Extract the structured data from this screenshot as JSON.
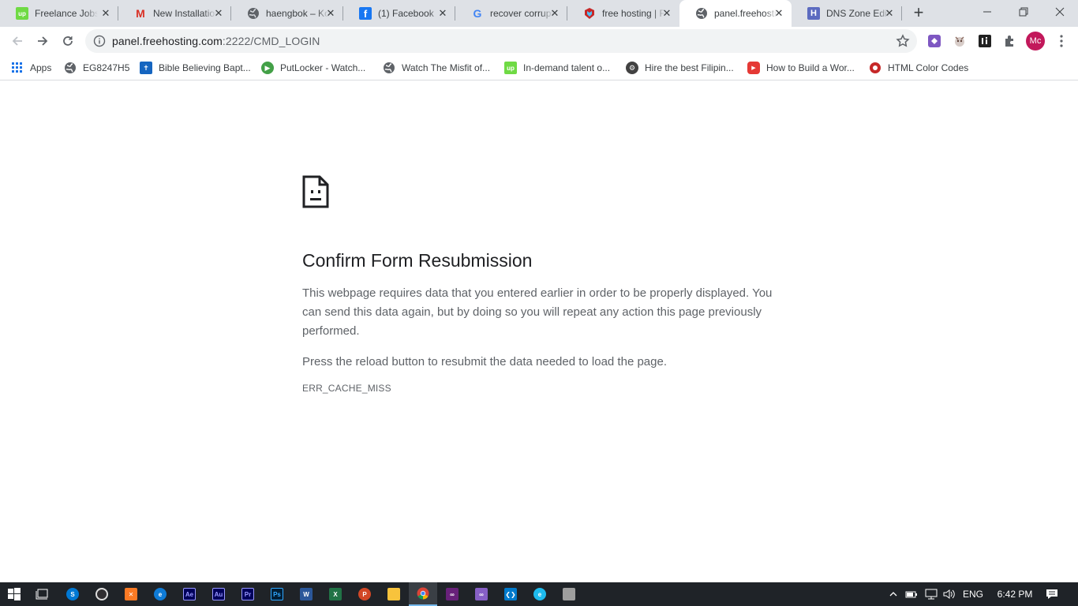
{
  "tabs": [
    {
      "title": "Freelance Jobs",
      "favicon": "upwork-icon",
      "color": "#6fda44",
      "glyph": "up"
    },
    {
      "title": "New Installation",
      "favicon": "gmail-icon",
      "color": "#ffffff",
      "glyph": "M"
    },
    {
      "title": "haengbok – Korean",
      "favicon": "globe-icon",
      "color": "#5f6368",
      "glyph": ""
    },
    {
      "title": "(1) Facebook",
      "favicon": "facebook-icon",
      "color": "#1877f2",
      "glyph": "f"
    },
    {
      "title": "recover corrupted",
      "favicon": "google-icon",
      "color": "#ffffff",
      "glyph": "G"
    },
    {
      "title": "free hosting | Free",
      "favicon": "freehosting-icon",
      "color": "#c62828",
      "glyph": ""
    },
    {
      "title": "panel.freehosting",
      "favicon": "globe-icon",
      "color": "#5f6368",
      "glyph": ""
    },
    {
      "title": "DNS Zone Editor",
      "favicon": "dns-icon",
      "color": "#5c6bc0",
      "glyph": "H"
    }
  ],
  "omnibox": {
    "host": "panel.freehosting.com",
    "path": ":2222/CMD_LOGIN"
  },
  "profile_initials": "Mc",
  "bookmarks": [
    {
      "label": "Apps",
      "icon": "apps-grid-icon"
    },
    {
      "label": "EG8247H5",
      "icon": "globe-icon"
    },
    {
      "label": "Bible Believing Bapt...",
      "icon": "bible-icon"
    },
    {
      "label": "PutLocker - Watch...",
      "icon": "play-icon"
    },
    {
      "label": "Watch The Misfit of...",
      "icon": "globe-icon"
    },
    {
      "label": "In-demand talent o...",
      "icon": "upwork-icon"
    },
    {
      "label": "Hire the best Filipin...",
      "icon": "onlinejobs-icon"
    },
    {
      "label": "How to Build a Wor...",
      "icon": "youtube-icon"
    },
    {
      "label": "HTML Color Codes",
      "icon": "colorcodes-icon"
    }
  ],
  "error": {
    "title": "Confirm Form Resubmission",
    "message": "This webpage requires data that you entered earlier in order to be properly displayed. You can send this data again, but by doing so you will repeat any action this page previously performed.",
    "instruction": "Press the reload button to resubmit the data needed to load the page.",
    "code": "ERR_CACHE_MISS"
  },
  "taskbar": {
    "apps": [
      {
        "name": "start-icon",
        "glyph": ""
      },
      {
        "name": "task-view-icon",
        "glyph": ""
      },
      {
        "name": "skype-icon",
        "glyph": "S"
      },
      {
        "name": "obs-icon",
        "glyph": ""
      },
      {
        "name": "xampp-icon",
        "glyph": ""
      },
      {
        "name": "edge-icon",
        "glyph": ""
      },
      {
        "name": "after-effects-icon",
        "glyph": "Ae"
      },
      {
        "name": "audition-icon",
        "glyph": "Au"
      },
      {
        "name": "premiere-icon",
        "glyph": "Pr"
      },
      {
        "name": "photoshop-icon",
        "glyph": "Ps"
      },
      {
        "name": "word-icon",
        "glyph": "W"
      },
      {
        "name": "excel-icon",
        "glyph": "X"
      },
      {
        "name": "powerpoint-icon",
        "glyph": "P"
      },
      {
        "name": "file-explorer-icon",
        "glyph": ""
      },
      {
        "name": "chrome-icon",
        "glyph": ""
      },
      {
        "name": "visual-studio-icon",
        "glyph": ""
      },
      {
        "name": "visual-studio-2-icon",
        "glyph": ""
      },
      {
        "name": "vscode-icon",
        "glyph": ""
      },
      {
        "name": "ie-icon",
        "glyph": ""
      },
      {
        "name": "remote-desktop-icon",
        "glyph": ""
      }
    ],
    "language": "ENG",
    "time": "6:42 PM"
  }
}
